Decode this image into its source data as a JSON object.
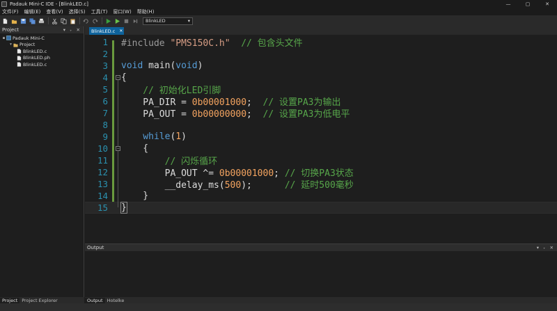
{
  "window": {
    "title": "Padauk Mini-C IDE - [BlinkLED.c]",
    "controls": [
      "—",
      "▢",
      "✕"
    ]
  },
  "menu": [
    "文件(F)",
    "编辑(E)",
    "查看(V)",
    "选择(S)",
    "工具(T)",
    "窗口(W)",
    "帮助(H)"
  ],
  "toolbar": {
    "target_value": "BlinkLED",
    "icons": [
      "new-file",
      "open",
      "save",
      "save-all",
      "print",
      "cut",
      "copy",
      "paste",
      "undo",
      "redo",
      "build",
      "run",
      "stop",
      "step"
    ]
  },
  "project_panel": {
    "title": "Project",
    "header_icons": "▾ ₊ ✕",
    "tree": [
      {
        "label": "Padauk Mini-C",
        "level": 0,
        "expander": "▪",
        "icon": "project-icon"
      },
      {
        "label": "Project",
        "level": 1,
        "expander": "▾",
        "icon": "folder-icon"
      },
      {
        "label": "BlinkLED.c",
        "level": 2,
        "expander": "",
        "icon": "c-file-icon"
      },
      {
        "label": "BlinkLED.ph",
        "level": 2,
        "expander": "",
        "icon": "header-file-icon"
      },
      {
        "label": "BlinkLED.c",
        "level": 2,
        "expander": "",
        "icon": "c-file-icon"
      }
    ],
    "tabs": [
      "Project",
      "Project Explorer"
    ]
  },
  "editor": {
    "tab_label": "BlinkLED.c",
    "tab_close": "✕",
    "current_line": 15,
    "lines": [
      {
        "n": "1",
        "tokens": [
          [
            "pre",
            "#include "
          ],
          [
            "str",
            "\"PMS150C.h\""
          ],
          [
            "com",
            "  // 包含头文件"
          ]
        ]
      },
      {
        "n": "2",
        "tokens": []
      },
      {
        "n": "3",
        "tokens": [
          [
            "kw",
            "void"
          ],
          [
            "id",
            " main("
          ],
          [
            "kw",
            "void"
          ],
          [
            "id",
            ")"
          ]
        ]
      },
      {
        "n": "4",
        "tokens": [
          [
            "id",
            "{"
          ]
        ]
      },
      {
        "n": "5",
        "tokens": [
          [
            "com",
            "    // 初始化LED引脚"
          ]
        ]
      },
      {
        "n": "6",
        "tokens": [
          [
            "id",
            "    PA_DIR = "
          ],
          [
            "num",
            "0b00001000"
          ],
          [
            "id",
            ";  "
          ],
          [
            "com",
            "// 设置PA3为输出"
          ]
        ]
      },
      {
        "n": "7",
        "tokens": [
          [
            "id",
            "    PA_OUT = "
          ],
          [
            "num",
            "0b00000000"
          ],
          [
            "id",
            ";  "
          ],
          [
            "com",
            "// 设置PA3为低电平"
          ]
        ]
      },
      {
        "n": "8",
        "tokens": []
      },
      {
        "n": "9",
        "tokens": [
          [
            "kw",
            "    while"
          ],
          [
            "id",
            "("
          ],
          [
            "num",
            "1"
          ],
          [
            "id",
            ")"
          ]
        ]
      },
      {
        "n": "10",
        "tokens": [
          [
            "id",
            "    {"
          ]
        ]
      },
      {
        "n": "11",
        "tokens": [
          [
            "com",
            "        // 闪烁循环"
          ]
        ]
      },
      {
        "n": "12",
        "tokens": [
          [
            "id",
            "        PA_OUT ^= "
          ],
          [
            "num",
            "0b00001000"
          ],
          [
            "id",
            "; "
          ],
          [
            "com",
            "// 切换PA3状态"
          ]
        ]
      },
      {
        "n": "13",
        "tokens": [
          [
            "id",
            "        __delay_ms("
          ],
          [
            "num",
            "500"
          ],
          [
            "id",
            ");      "
          ],
          [
            "com",
            "// 延时500毫秒"
          ]
        ]
      },
      {
        "n": "14",
        "tokens": [
          [
            "id",
            "    }"
          ]
        ]
      },
      {
        "n": "15",
        "tokens": [
          [
            "id",
            "}"
          ]
        ]
      }
    ]
  },
  "output_panel": {
    "title": "Output",
    "header_icons": "▾ ₊ ✕",
    "tabs": [
      "Output",
      "Hotelke"
    ]
  },
  "colors": {
    "accent": "#0e639c",
    "keyword": "#569cd6",
    "string": "#d69d85",
    "comment": "#57a64a",
    "number": "#f4a460",
    "line_number": "#2b91af",
    "change_bar": "#6a9a3e"
  }
}
